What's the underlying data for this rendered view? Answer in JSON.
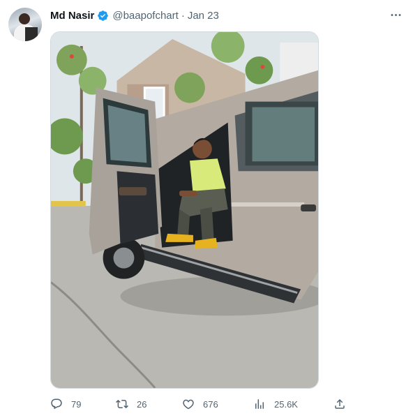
{
  "tweet": {
    "author": {
      "name": "Md Nasir",
      "handle": "@baapofchart",
      "verified": true,
      "avatar_icon": "profile-photo"
    },
    "separator": "·",
    "date": "Jan 23",
    "media": {
      "icon": "photo-man-sitting-in-open-silver-suv-door"
    },
    "actions": {
      "reply": {
        "icon": "reply-icon",
        "count": "79"
      },
      "retweet": {
        "icon": "retweet-icon",
        "count": "26"
      },
      "like": {
        "icon": "heart-icon",
        "count": "676"
      },
      "views": {
        "icon": "analytics-icon",
        "count": "25.6K"
      },
      "share": {
        "icon": "share-icon"
      }
    }
  },
  "colors": {
    "accent_blue": "#1d9bf0",
    "text_primary": "#0f1419",
    "text_secondary": "#536471"
  }
}
